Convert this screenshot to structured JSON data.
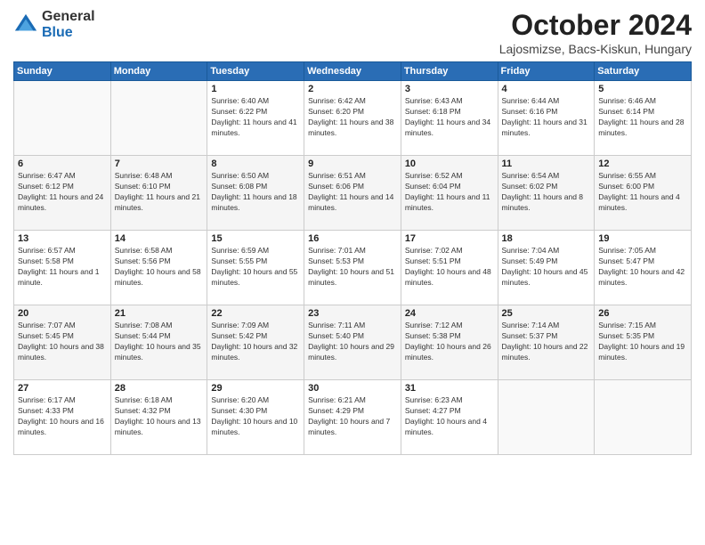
{
  "logo": {
    "general": "General",
    "blue": "Blue"
  },
  "title": "October 2024",
  "location": "Lajosmizse, Bacs-Kiskun, Hungary",
  "header_days": [
    "Sunday",
    "Monday",
    "Tuesday",
    "Wednesday",
    "Thursday",
    "Friday",
    "Saturday"
  ],
  "weeks": [
    [
      {
        "day": "",
        "info": ""
      },
      {
        "day": "",
        "info": ""
      },
      {
        "day": "1",
        "info": "Sunrise: 6:40 AM\nSunset: 6:22 PM\nDaylight: 11 hours and 41 minutes."
      },
      {
        "day": "2",
        "info": "Sunrise: 6:42 AM\nSunset: 6:20 PM\nDaylight: 11 hours and 38 minutes."
      },
      {
        "day": "3",
        "info": "Sunrise: 6:43 AM\nSunset: 6:18 PM\nDaylight: 11 hours and 34 minutes."
      },
      {
        "day": "4",
        "info": "Sunrise: 6:44 AM\nSunset: 6:16 PM\nDaylight: 11 hours and 31 minutes."
      },
      {
        "day": "5",
        "info": "Sunrise: 6:46 AM\nSunset: 6:14 PM\nDaylight: 11 hours and 28 minutes."
      }
    ],
    [
      {
        "day": "6",
        "info": "Sunrise: 6:47 AM\nSunset: 6:12 PM\nDaylight: 11 hours and 24 minutes."
      },
      {
        "day": "7",
        "info": "Sunrise: 6:48 AM\nSunset: 6:10 PM\nDaylight: 11 hours and 21 minutes."
      },
      {
        "day": "8",
        "info": "Sunrise: 6:50 AM\nSunset: 6:08 PM\nDaylight: 11 hours and 18 minutes."
      },
      {
        "day": "9",
        "info": "Sunrise: 6:51 AM\nSunset: 6:06 PM\nDaylight: 11 hours and 14 minutes."
      },
      {
        "day": "10",
        "info": "Sunrise: 6:52 AM\nSunset: 6:04 PM\nDaylight: 11 hours and 11 minutes."
      },
      {
        "day": "11",
        "info": "Sunrise: 6:54 AM\nSunset: 6:02 PM\nDaylight: 11 hours and 8 minutes."
      },
      {
        "day": "12",
        "info": "Sunrise: 6:55 AM\nSunset: 6:00 PM\nDaylight: 11 hours and 4 minutes."
      }
    ],
    [
      {
        "day": "13",
        "info": "Sunrise: 6:57 AM\nSunset: 5:58 PM\nDaylight: 11 hours and 1 minute."
      },
      {
        "day": "14",
        "info": "Sunrise: 6:58 AM\nSunset: 5:56 PM\nDaylight: 10 hours and 58 minutes."
      },
      {
        "day": "15",
        "info": "Sunrise: 6:59 AM\nSunset: 5:55 PM\nDaylight: 10 hours and 55 minutes."
      },
      {
        "day": "16",
        "info": "Sunrise: 7:01 AM\nSunset: 5:53 PM\nDaylight: 10 hours and 51 minutes."
      },
      {
        "day": "17",
        "info": "Sunrise: 7:02 AM\nSunset: 5:51 PM\nDaylight: 10 hours and 48 minutes."
      },
      {
        "day": "18",
        "info": "Sunrise: 7:04 AM\nSunset: 5:49 PM\nDaylight: 10 hours and 45 minutes."
      },
      {
        "day": "19",
        "info": "Sunrise: 7:05 AM\nSunset: 5:47 PM\nDaylight: 10 hours and 42 minutes."
      }
    ],
    [
      {
        "day": "20",
        "info": "Sunrise: 7:07 AM\nSunset: 5:45 PM\nDaylight: 10 hours and 38 minutes."
      },
      {
        "day": "21",
        "info": "Sunrise: 7:08 AM\nSunset: 5:44 PM\nDaylight: 10 hours and 35 minutes."
      },
      {
        "day": "22",
        "info": "Sunrise: 7:09 AM\nSunset: 5:42 PM\nDaylight: 10 hours and 32 minutes."
      },
      {
        "day": "23",
        "info": "Sunrise: 7:11 AM\nSunset: 5:40 PM\nDaylight: 10 hours and 29 minutes."
      },
      {
        "day": "24",
        "info": "Sunrise: 7:12 AM\nSunset: 5:38 PM\nDaylight: 10 hours and 26 minutes."
      },
      {
        "day": "25",
        "info": "Sunrise: 7:14 AM\nSunset: 5:37 PM\nDaylight: 10 hours and 22 minutes."
      },
      {
        "day": "26",
        "info": "Sunrise: 7:15 AM\nSunset: 5:35 PM\nDaylight: 10 hours and 19 minutes."
      }
    ],
    [
      {
        "day": "27",
        "info": "Sunrise: 6:17 AM\nSunset: 4:33 PM\nDaylight: 10 hours and 16 minutes."
      },
      {
        "day": "28",
        "info": "Sunrise: 6:18 AM\nSunset: 4:32 PM\nDaylight: 10 hours and 13 minutes."
      },
      {
        "day": "29",
        "info": "Sunrise: 6:20 AM\nSunset: 4:30 PM\nDaylight: 10 hours and 10 minutes."
      },
      {
        "day": "30",
        "info": "Sunrise: 6:21 AM\nSunset: 4:29 PM\nDaylight: 10 hours and 7 minutes."
      },
      {
        "day": "31",
        "info": "Sunrise: 6:23 AM\nSunset: 4:27 PM\nDaylight: 10 hours and 4 minutes."
      },
      {
        "day": "",
        "info": ""
      },
      {
        "day": "",
        "info": ""
      }
    ]
  ]
}
